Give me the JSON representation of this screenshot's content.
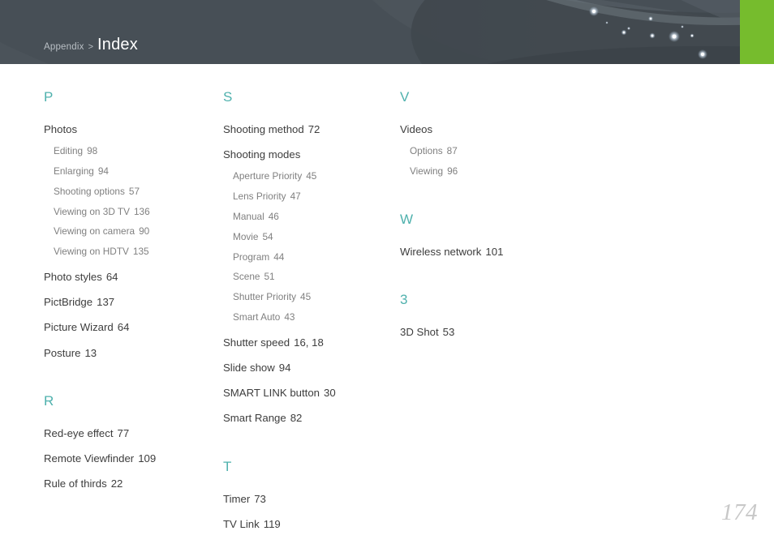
{
  "header": {
    "breadcrumb_parent": "Appendix",
    "breadcrumb_separator": ">",
    "breadcrumb_current": "Index",
    "accent_color": "#76bc2d",
    "band_color": "#474f56"
  },
  "theme": {
    "letter_color": "#4fb1ad",
    "entry_color": "#3d3d3d",
    "subentry_color": "#808080",
    "page_number_color": "#c8c8c8"
  },
  "columns": [
    {
      "sections": [
        {
          "letter": "P",
          "entries": [
            {
              "label": "Photos",
              "page": "",
              "subentries": [
                {
                  "label": "Editing",
                  "page": "98"
                },
                {
                  "label": "Enlarging",
                  "page": "94"
                },
                {
                  "label": "Shooting options",
                  "page": "57"
                },
                {
                  "label": "Viewing on 3D TV",
                  "page": "136"
                },
                {
                  "label": "Viewing on camera",
                  "page": "90"
                },
                {
                  "label": "Viewing on HDTV",
                  "page": "135"
                }
              ]
            },
            {
              "label": "Photo styles",
              "page": "64",
              "subentries": []
            },
            {
              "label": "PictBridge",
              "page": "137",
              "subentries": []
            },
            {
              "label": "Picture Wizard",
              "page": "64",
              "subentries": []
            },
            {
              "label": "Posture",
              "page": "13",
              "subentries": []
            }
          ]
        },
        {
          "letter": "R",
          "entries": [
            {
              "label": "Red-eye effect",
              "page": "77",
              "subentries": []
            },
            {
              "label": "Remote Viewfinder",
              "page": "109",
              "subentries": []
            },
            {
              "label": "Rule of thirds",
              "page": "22",
              "subentries": []
            }
          ]
        }
      ]
    },
    {
      "sections": [
        {
          "letter": "S",
          "entries": [
            {
              "label": "Shooting method",
              "page": "72",
              "subentries": []
            },
            {
              "label": "Shooting modes",
              "page": "",
              "subentries": [
                {
                  "label": "Aperture Priority",
                  "page": "45"
                },
                {
                  "label": "Lens Priority",
                  "page": "47"
                },
                {
                  "label": "Manual",
                  "page": "46"
                },
                {
                  "label": "Movie",
                  "page": "54"
                },
                {
                  "label": "Program",
                  "page": "44"
                },
                {
                  "label": "Scene",
                  "page": "51"
                },
                {
                  "label": "Shutter Priority",
                  "page": "45"
                },
                {
                  "label": "Smart Auto",
                  "page": "43"
                }
              ]
            },
            {
              "label": "Shutter speed",
              "page": "16, 18",
              "subentries": []
            },
            {
              "label": "Slide show",
              "page": "94",
              "subentries": []
            },
            {
              "label": "SMART LINK button",
              "page": "30",
              "subentries": []
            },
            {
              "label": "Smart Range",
              "page": "82",
              "subentries": []
            }
          ]
        },
        {
          "letter": "T",
          "entries": [
            {
              "label": "Timer",
              "page": "73",
              "subentries": []
            },
            {
              "label": "TV Link",
              "page": "119",
              "subentries": []
            }
          ]
        }
      ]
    },
    {
      "sections": [
        {
          "letter": "V",
          "entries": [
            {
              "label": "Videos",
              "page": "",
              "subentries": [
                {
                  "label": "Options",
                  "page": "87"
                },
                {
                  "label": "Viewing",
                  "page": "96"
                }
              ]
            }
          ]
        },
        {
          "letter": "W",
          "entries": [
            {
              "label": "Wireless network",
              "page": "101",
              "subentries": []
            }
          ]
        },
        {
          "letter": "3",
          "entries": [
            {
              "label": "3D Shot",
              "page": "53",
              "subentries": []
            }
          ]
        }
      ]
    }
  ],
  "footer": {
    "page_number": "174"
  }
}
